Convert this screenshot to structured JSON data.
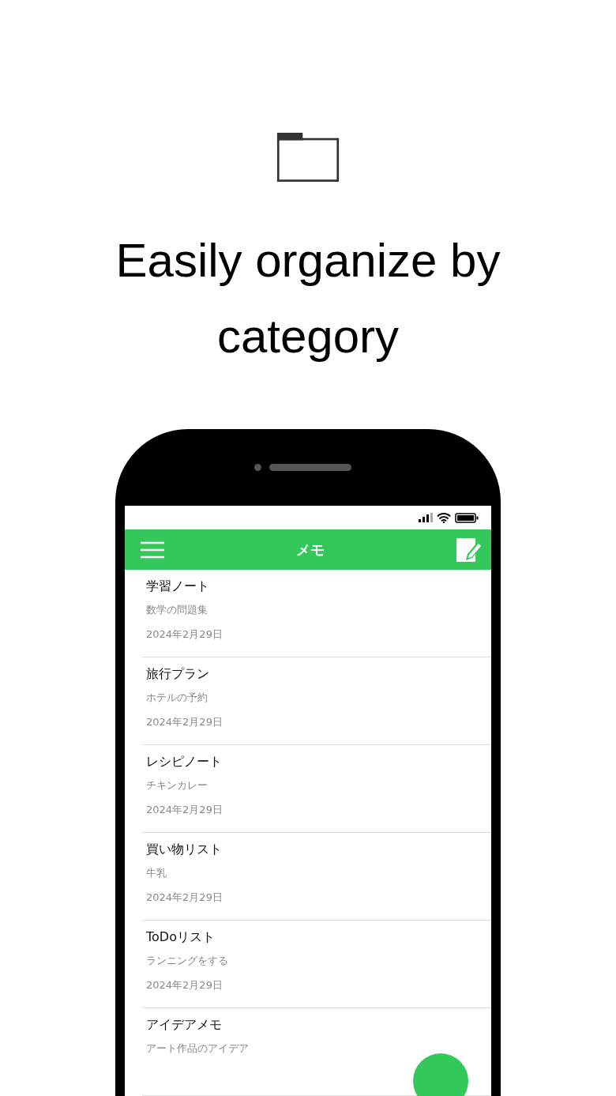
{
  "headline": "Easily organize by category",
  "app_bar": {
    "title": "メモ"
  },
  "notes": [
    {
      "title": "学習ノート",
      "subtitle": "数学の問題集",
      "date": "2024年2月29日"
    },
    {
      "title": "旅行プラン",
      "subtitle": "ホテルの予約",
      "date": "2024年2月29日"
    },
    {
      "title": "レシピノート",
      "subtitle": "チキンカレー",
      "date": "2024年2月29日"
    },
    {
      "title": "買い物リスト",
      "subtitle": "牛乳",
      "date": "2024年2月29日"
    },
    {
      "title": "ToDoリスト",
      "subtitle": "ランニングをする",
      "date": "2024年2月29日"
    },
    {
      "title": "アイデアメモ",
      "subtitle": "アート作品のアイデア"
    }
  ]
}
